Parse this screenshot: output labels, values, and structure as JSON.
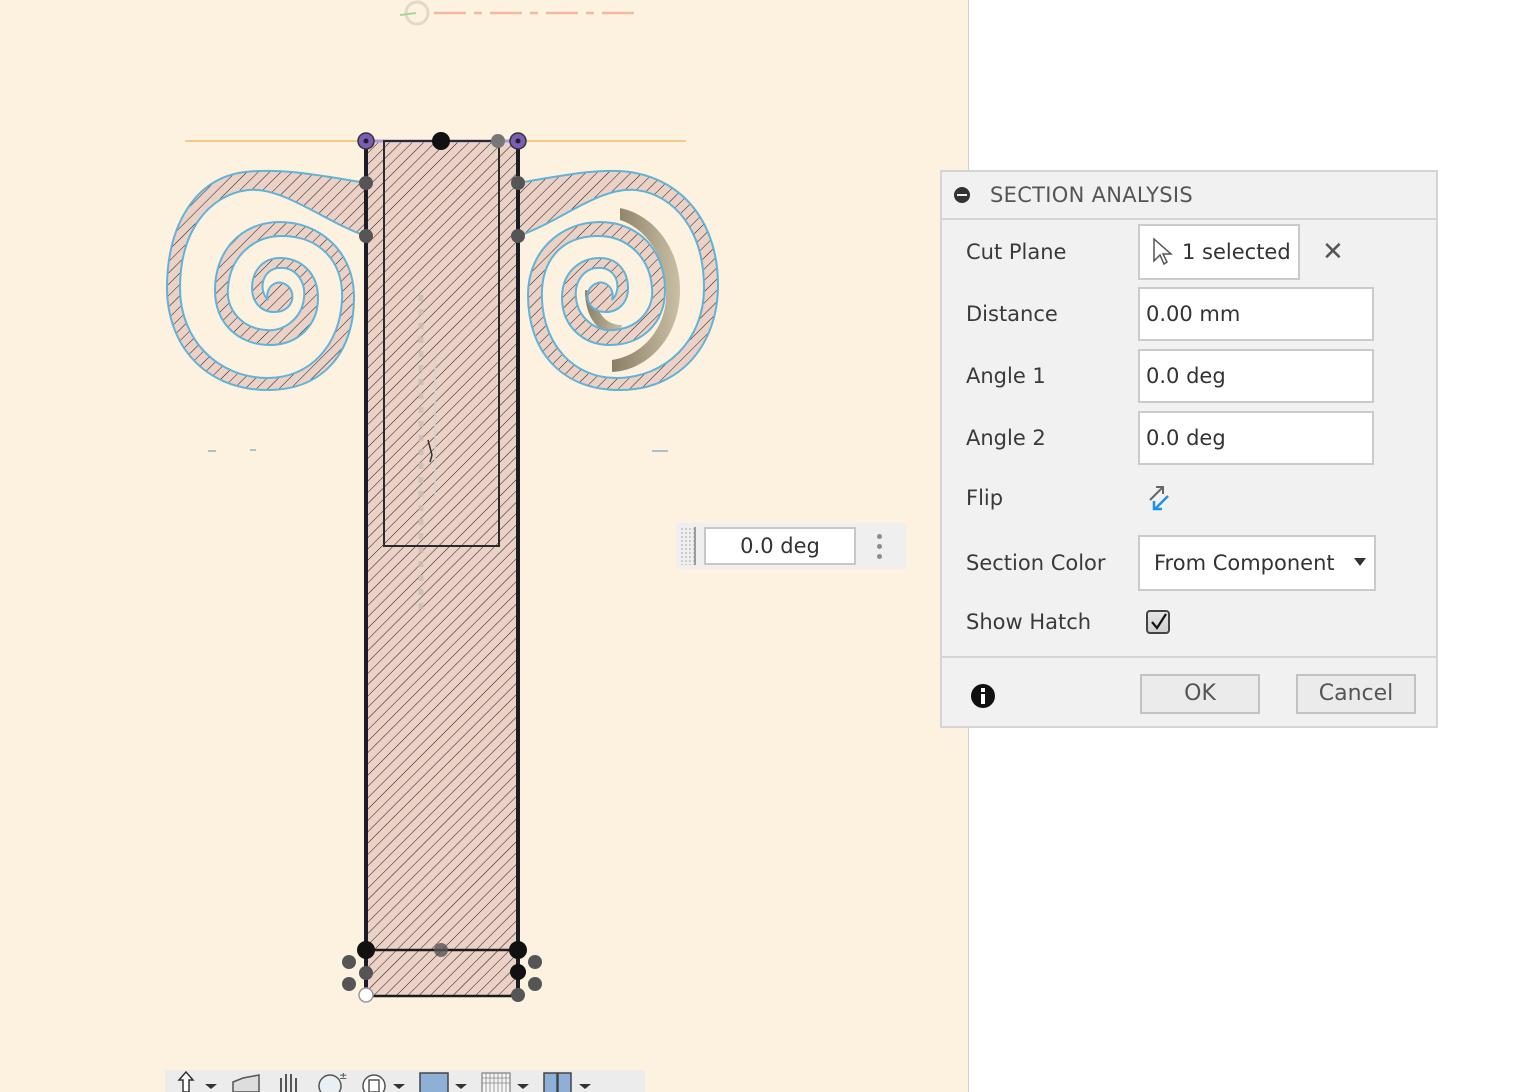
{
  "viewport": {
    "background": "#fdf2e0",
    "section_hatch_color": "#e9cfc4",
    "profile_outline_color": "#5fb3d9",
    "angle_manipulator": {
      "value": "0.0 deg"
    }
  },
  "nav_toolbar": {
    "tools": [
      {
        "name": "orbit",
        "icon": "orbit-icon",
        "has_dropdown": true
      },
      {
        "name": "look-at",
        "icon": "look-at-icon",
        "has_dropdown": false
      },
      {
        "name": "pan",
        "icon": "pan-hand-icon",
        "has_dropdown": false
      },
      {
        "name": "zoom",
        "icon": "zoom-icon",
        "has_dropdown": false
      },
      {
        "name": "fit",
        "icon": "fit-icon",
        "has_dropdown": true
      },
      {
        "name": "display-settings",
        "icon": "display-settings-icon",
        "has_dropdown": true
      },
      {
        "name": "grid-snaps",
        "icon": "grid-icon",
        "has_dropdown": true
      },
      {
        "name": "viewports",
        "icon": "viewports-icon",
        "has_dropdown": true
      }
    ]
  },
  "dialog": {
    "title": "SECTION ANALYSIS",
    "fields": {
      "cut_plane": {
        "label": "Cut Plane",
        "value": "1 selected"
      },
      "distance": {
        "label": "Distance",
        "value": "0.00 mm"
      },
      "angle1": {
        "label": "Angle 1",
        "value": "0.0 deg"
      },
      "angle2": {
        "label": "Angle 2",
        "value": "0.0 deg"
      },
      "flip": {
        "label": "Flip"
      },
      "section_color": {
        "label": "Section Color",
        "value": "From Component"
      },
      "show_hatch": {
        "label": "Show Hatch",
        "checked": true
      }
    },
    "buttons": {
      "ok": "OK",
      "cancel": "Cancel"
    },
    "accent_color": "#1e90e6"
  }
}
